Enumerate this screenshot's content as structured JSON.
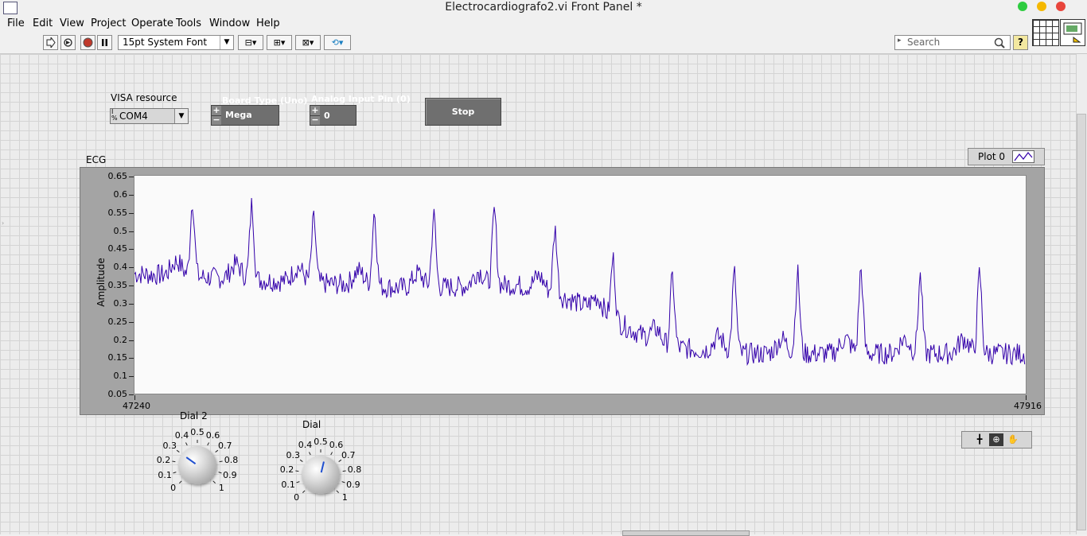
{
  "window": {
    "title": "Electrocardiografo2.vi Front Panel *",
    "buttons": [
      "green",
      "yellow",
      "red"
    ],
    "colors": {
      "green": "#2ecc40",
      "yellow": "#f5b800",
      "red": "#e8453c"
    }
  },
  "menu": [
    "File",
    "Edit",
    "View",
    "Project",
    "Operate",
    "Tools",
    "Window",
    "Help"
  ],
  "toolbar": {
    "font_selector": "15pt System Font",
    "search_placeholder": "Search",
    "help_label": "?"
  },
  "controls": {
    "visa": {
      "label": "VISA resource",
      "value": "COM4"
    },
    "board_type": {
      "label": "Board Type (Uno)",
      "value": "Mega"
    },
    "analog_pin": {
      "label": "Analog Input Pin (0)",
      "value": "0"
    },
    "stop": {
      "label": "Stop"
    }
  },
  "graph": {
    "label": "ECG",
    "legend": "Plot 0",
    "y_axis_label": "Amplitude",
    "y_ticks": [
      "0.65",
      "0.6",
      "0.55",
      "0.5",
      "0.45",
      "0.4",
      "0.35",
      "0.3",
      "0.25",
      "0.2",
      "0.15",
      "0.1",
      "0.05"
    ],
    "x_start": "47240",
    "x_end": "47916",
    "trace_color": "#3300aa"
  },
  "chart_data": {
    "type": "line",
    "title": "ECG",
    "xlabel": "",
    "ylabel": "Amplitude",
    "xlim": [
      47240,
      47916
    ],
    "ylim": [
      0.05,
      0.65
    ],
    "series": [
      {
        "name": "Plot 0",
        "peaks": [
          {
            "x": 47284,
            "y": 0.58
          },
          {
            "x": 47329,
            "y": 0.57
          },
          {
            "x": 47376,
            "y": 0.53
          },
          {
            "x": 47422,
            "y": 0.55
          },
          {
            "x": 47467,
            "y": 0.54
          },
          {
            "x": 47513,
            "y": 0.55
          },
          {
            "x": 47559,
            "y": 0.5
          },
          {
            "x": 47603,
            "y": 0.42
          },
          {
            "x": 47648,
            "y": 0.37
          },
          {
            "x": 47695,
            "y": 0.38
          },
          {
            "x": 47743,
            "y": 0.38
          },
          {
            "x": 47791,
            "y": 0.39
          },
          {
            "x": 47836,
            "y": 0.37
          },
          {
            "x": 47881,
            "y": 0.38
          }
        ],
        "baseline": [
          {
            "x": 47240,
            "y": 0.38
          },
          {
            "x": 47350,
            "y": 0.36
          },
          {
            "x": 47450,
            "y": 0.34
          },
          {
            "x": 47530,
            "y": 0.35
          },
          {
            "x": 47570,
            "y": 0.31
          },
          {
            "x": 47600,
            "y": 0.26
          },
          {
            "x": 47640,
            "y": 0.18
          },
          {
            "x": 47700,
            "y": 0.16
          },
          {
            "x": 47800,
            "y": 0.16
          },
          {
            "x": 47916,
            "y": 0.16
          }
        ]
      }
    ]
  },
  "dials": [
    {
      "label": "Dial 2",
      "value": 0.3,
      "ticks": [
        "0",
        "0.1",
        "0.2",
        "0.3",
        "0.4",
        "0.5",
        "0.6",
        "0.7",
        "0.8",
        "0.9",
        "1"
      ]
    },
    {
      "label": "Dial",
      "value": 0.55,
      "ticks": [
        "0",
        "0.1",
        "0.2",
        "0.3",
        "0.4",
        "0.5",
        "0.6",
        "0.7",
        "0.8",
        "0.9",
        "1"
      ]
    }
  ]
}
